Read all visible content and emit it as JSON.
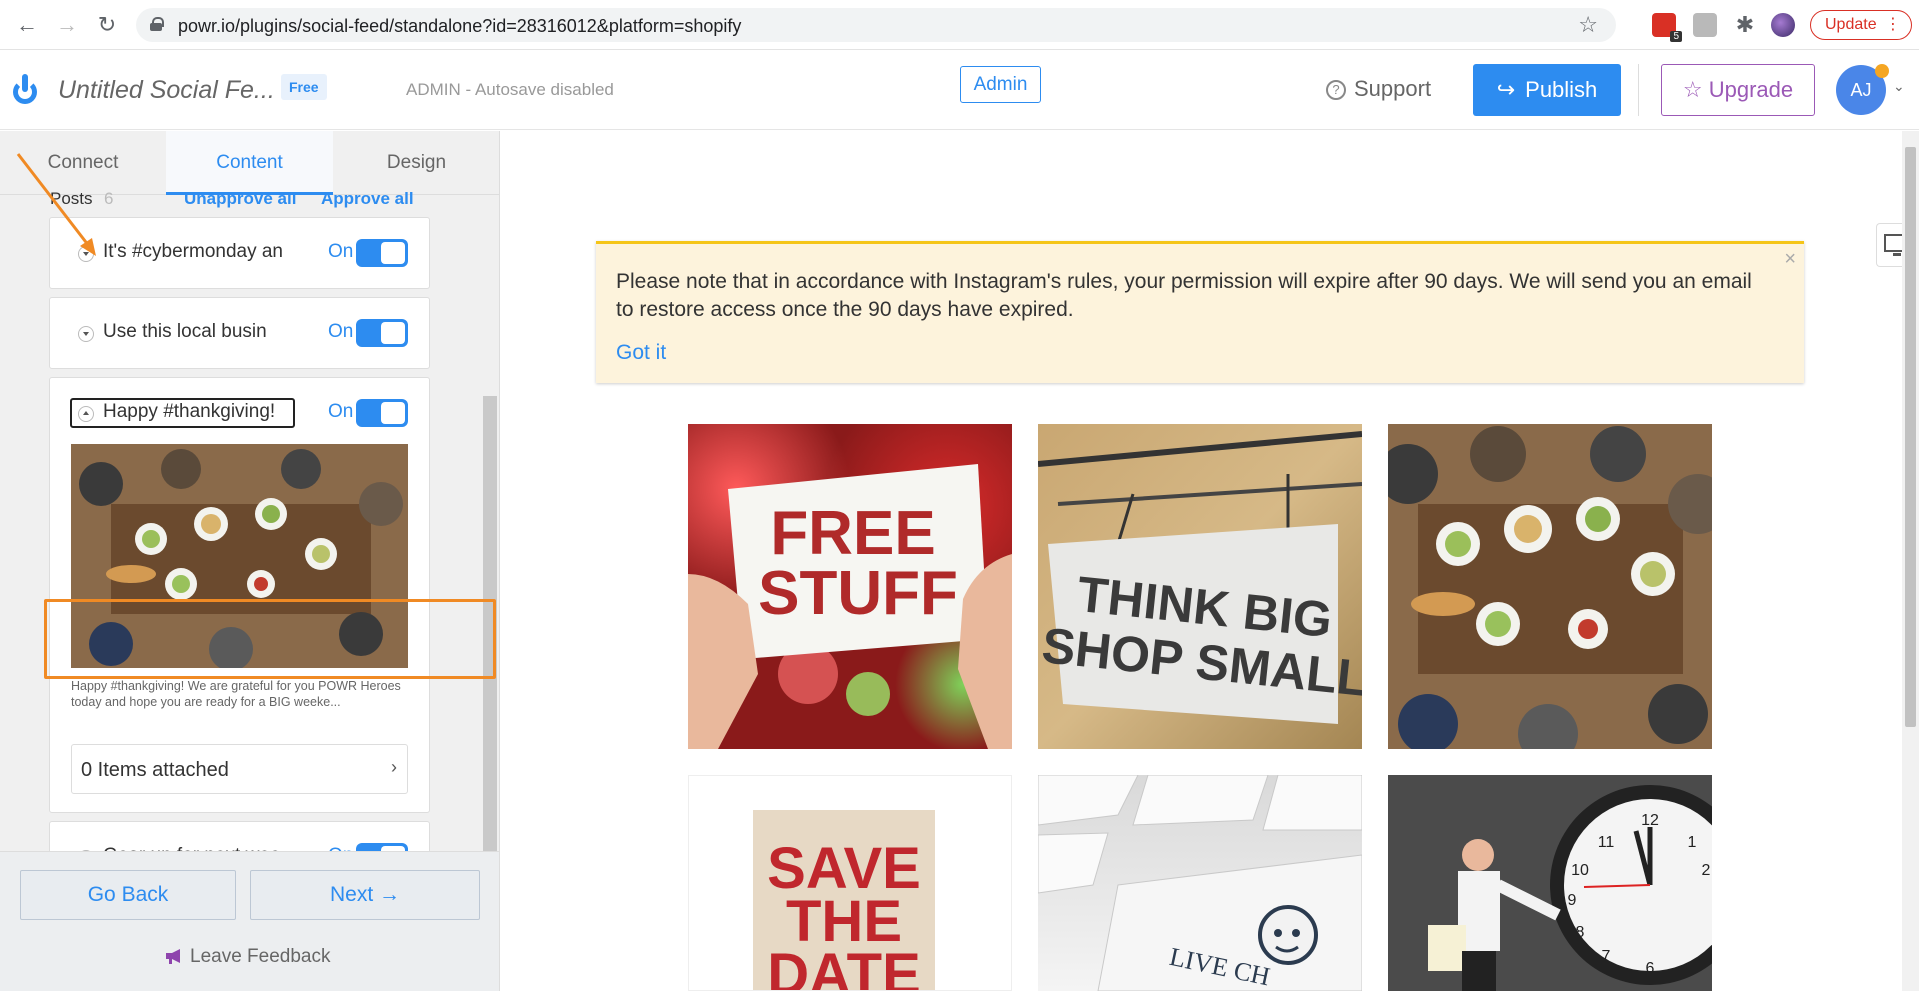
{
  "browser": {
    "url": "powr.io/plugins/social-feed/standalone?id=28316012&platform=shopify",
    "update_label": "Update",
    "ext_badge": "5"
  },
  "header": {
    "title": "Untitled Social Fe...",
    "plan_badge": "Free",
    "status": "ADMIN - Autosave disabled",
    "admin_label": "Admin",
    "support_label": "Support",
    "publish_label": "Publish",
    "upgrade_label": "Upgrade",
    "avatar_initials": "AJ"
  },
  "tabs": {
    "connect": "Connect",
    "content": "Content",
    "design": "Design"
  },
  "posts": {
    "label": "Posts",
    "count": "6",
    "unapprove_all": "Unapprove all",
    "approve_all": "Approve all",
    "on_label": "On",
    "items": [
      {
        "title": "It's #cybermonday an"
      },
      {
        "title": "Use this local busin"
      },
      {
        "title": "Happy #thankgiving!"
      },
      {
        "title": "Gear up for next wee"
      }
    ],
    "expanded": {
      "description": "Happy #thankgiving! We are grateful for you POWR Heroes today and hope you are ready for a BIG weeke...",
      "attachments": "0 Items attached"
    }
  },
  "footer": {
    "back": "Go Back",
    "next": "Next →",
    "feedback": "Leave Feedback"
  },
  "notice": {
    "text": "Please note that in accordance with Instagram's rules, your permission will expire after 90 days. We will send you an email to restore access once the 90 days have expired.",
    "link": "Got it",
    "close": "×"
  },
  "tiles": {
    "free_1": "FREE",
    "free_2": "STUFF",
    "think_1": "THINK BIG",
    "think_2": "SHOP SMALL",
    "save_1": "SAVE",
    "save_2": "THE",
    "save_3": "DATE",
    "live": "LIVE CH"
  },
  "colors": {
    "accent": "#2d8cf0",
    "upgrade": "#9b59b6",
    "highlight": "#f08a24",
    "notice_bg": "#fdf3dc"
  }
}
